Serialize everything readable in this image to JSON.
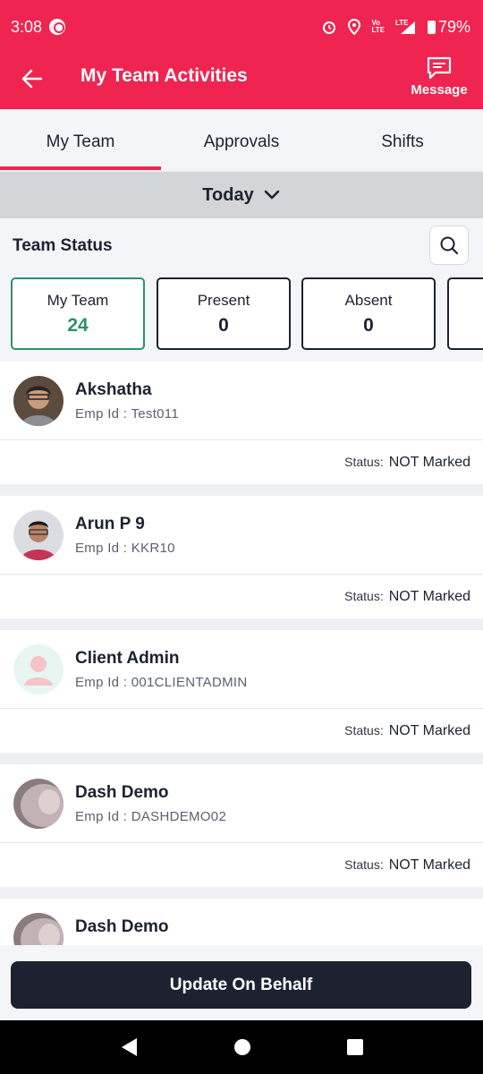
{
  "status_bar": {
    "time": "3:08",
    "battery": "79%",
    "network": "LTE"
  },
  "header": {
    "title": "My Team Activities",
    "message_label": "Message"
  },
  "tabs": [
    {
      "label": "My Team"
    },
    {
      "label": "Approvals"
    },
    {
      "label": "Shifts"
    }
  ],
  "date_selector": {
    "label": "Today"
  },
  "team_status": {
    "title": "Team Status",
    "cards": [
      {
        "label": "My Team",
        "value": "24"
      },
      {
        "label": "Present",
        "value": "0"
      },
      {
        "label": "Absent",
        "value": "0"
      }
    ]
  },
  "employees": [
    {
      "name": "Akshatha",
      "emp_id": "Emp Id : Test011",
      "status_key": "Status:",
      "status": "NOT Marked"
    },
    {
      "name": "Arun P 9",
      "emp_id": "Emp Id : KKR10",
      "status_key": "Status:",
      "status": "NOT Marked"
    },
    {
      "name": "Client Admin",
      "emp_id": "Emp Id : 001CLIENTADMIN",
      "status_key": "Status:",
      "status": "NOT Marked"
    },
    {
      "name": "Dash Demo",
      "emp_id": "Emp Id : DASHDEMO02",
      "status_key": "Status:",
      "status": "NOT Marked"
    },
    {
      "name": "Dash Demo"
    }
  ],
  "actions": {
    "update_label": "Update On Behalf"
  },
  "colors": {
    "primary": "#ef2450",
    "dark": "#1c2230",
    "accent_green": "#2d8f6f"
  }
}
